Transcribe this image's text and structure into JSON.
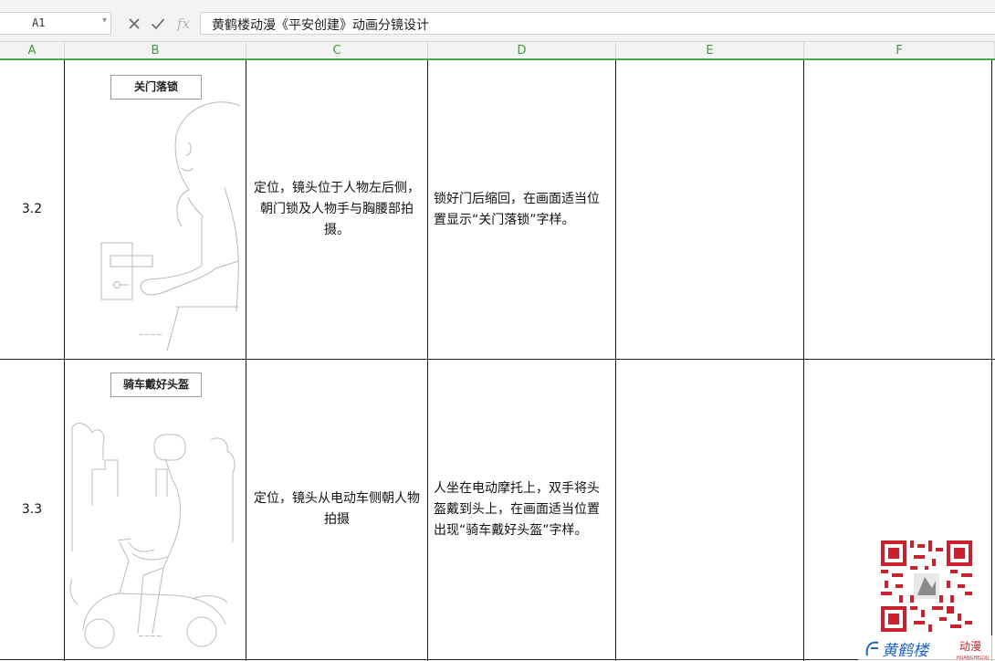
{
  "formula_bar": {
    "cell_ref": "A1",
    "content": "黄鹤楼动漫《平安创建》动画分镜设计",
    "fx": "fx"
  },
  "columns": [
    "A",
    "B",
    "C",
    "D",
    "E",
    "F"
  ],
  "rows": [
    {
      "shot": "3.2",
      "image_label": "关门落锁",
      "camera": "定位，镜头位于人物左后侧，朝门锁及人物手与胸腰部拍摄。",
      "description": "锁好门后缩回，在画面适当位置显示“关门落锁”字样。",
      "col_e": "",
      "col_f": ""
    },
    {
      "shot": "3.3",
      "image_label": "骑车戴好头盔",
      "camera": "定位，镜头从电动车侧朝人物拍摄",
      "description": "人坐在电动摩托上，双手将头盔戴到头上，在画面适当位置出现“骑车戴好头盔”字样。",
      "col_e": "",
      "col_f": ""
    }
  ],
  "logo": {
    "brand": "黄鹤楼",
    "tag": "动漫",
    "latin": "HUANGHELOU"
  },
  "colors": {
    "header_green": "#3d9b3d",
    "accent_red": "#cc1f2e",
    "logo_blue": "#1f66c8"
  }
}
